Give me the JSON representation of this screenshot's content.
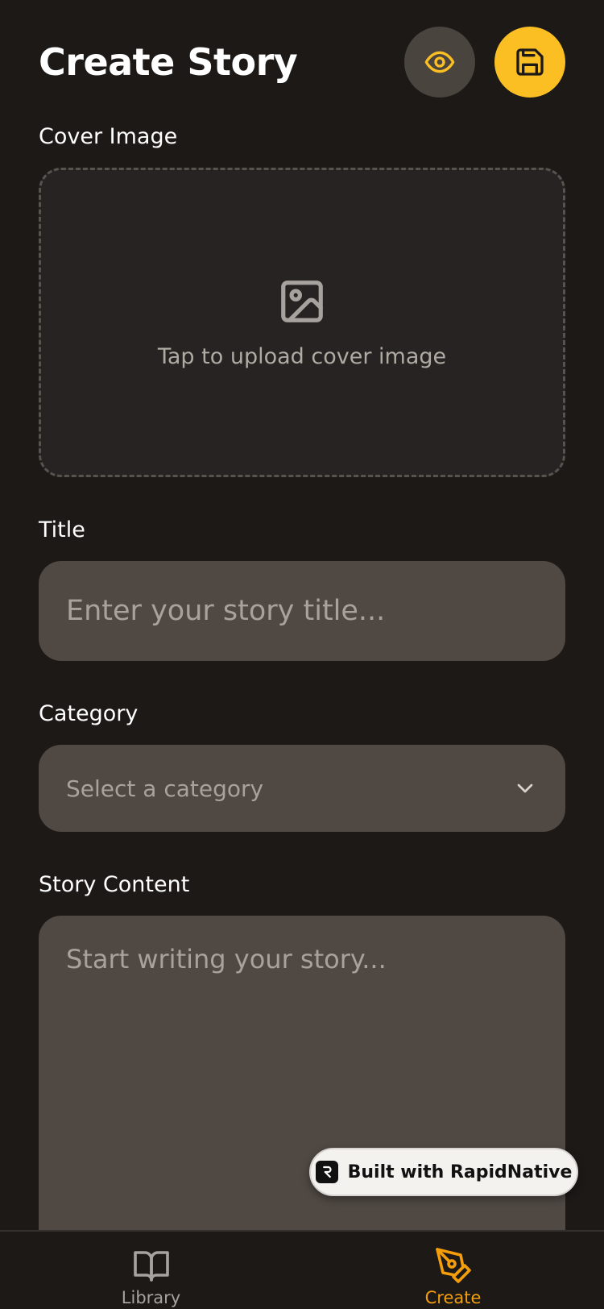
{
  "header": {
    "title": "Create Story",
    "preview_icon": "eye-icon",
    "save_icon": "floppy-disk-icon"
  },
  "cover": {
    "label": "Cover Image",
    "hint": "Tap to upload cover image",
    "icon": "image-icon"
  },
  "title_field": {
    "label": "Title",
    "placeholder": "Enter your story title..."
  },
  "category_field": {
    "label": "Category",
    "placeholder": "Select a category",
    "icon": "chevron-down-icon"
  },
  "content_field": {
    "label": "Story Content",
    "placeholder": "Start writing your story..."
  },
  "badge": {
    "text": "Built with RapidNative",
    "icon": "rapidnative-logo"
  },
  "tabs": [
    {
      "label": "Library",
      "icon": "book-open-icon",
      "active": false
    },
    {
      "label": "Create",
      "icon": "pen-tool-icon",
      "active": true
    }
  ],
  "colors": {
    "background": "#1c1917",
    "accent": "#fbbf24",
    "active_tab": "#f59e0b",
    "input_background": "#4f4843"
  }
}
